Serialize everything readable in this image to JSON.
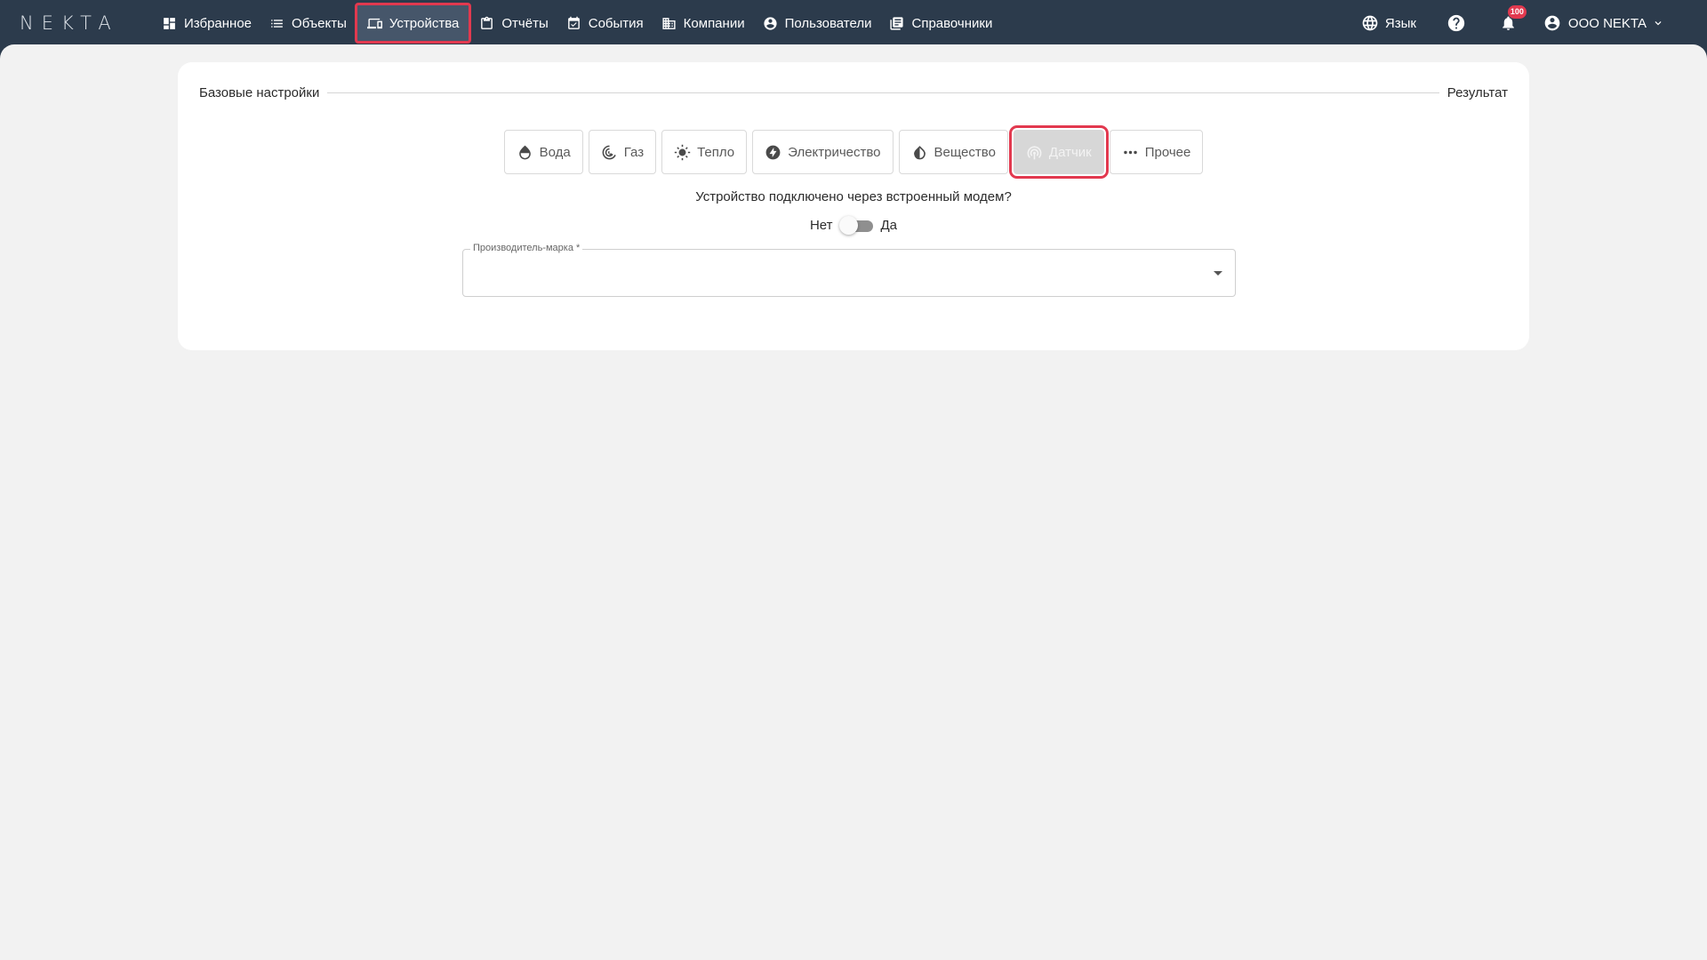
{
  "app": {
    "logo": "NEKTA"
  },
  "nav": {
    "items": [
      {
        "label": "Избранное",
        "icon": "dashboard-icon"
      },
      {
        "label": "Объекты",
        "icon": "list-icon"
      },
      {
        "label": "Устройства",
        "icon": "devices-icon",
        "active": true
      },
      {
        "label": "Отчёты",
        "icon": "clipboard-icon"
      },
      {
        "label": "События",
        "icon": "calendar-check-icon"
      },
      {
        "label": "Компании",
        "icon": "building-icon"
      },
      {
        "label": "Пользователи",
        "icon": "user-circle-icon"
      },
      {
        "label": "Справочники",
        "icon": "library-icon"
      }
    ]
  },
  "header": {
    "language_label": "Язык",
    "notifications_count": "100",
    "user_name": "ООО NEKTA"
  },
  "stepper": {
    "step1": "Базовые настройки",
    "step2": "Результат"
  },
  "device_types": [
    {
      "label": "Вода",
      "icon": "water-drop-icon"
    },
    {
      "label": "Газ",
      "icon": "gas-icon"
    },
    {
      "label": "Тепло",
      "icon": "sun-icon"
    },
    {
      "label": "Электричество",
      "icon": "lightning-icon"
    },
    {
      "label": "Вещество",
      "icon": "opacity-icon"
    },
    {
      "label": "Датчик",
      "icon": "antenna-icon",
      "selected": true
    },
    {
      "label": "Прочее",
      "icon": "more-dots-icon"
    }
  ],
  "form": {
    "modem_question": "Устройство подключено через встроенный модем?",
    "toggle_no": "Нет",
    "toggle_yes": "Да",
    "toggle_value": "Нет",
    "manufacturer_label": "Производитель-марка *",
    "manufacturer_value": ""
  },
  "colors": {
    "topbar": "#2c3b4c",
    "highlight": "#e2394f",
    "page_bg": "#f2f2f2",
    "card_bg": "#ffffff"
  }
}
